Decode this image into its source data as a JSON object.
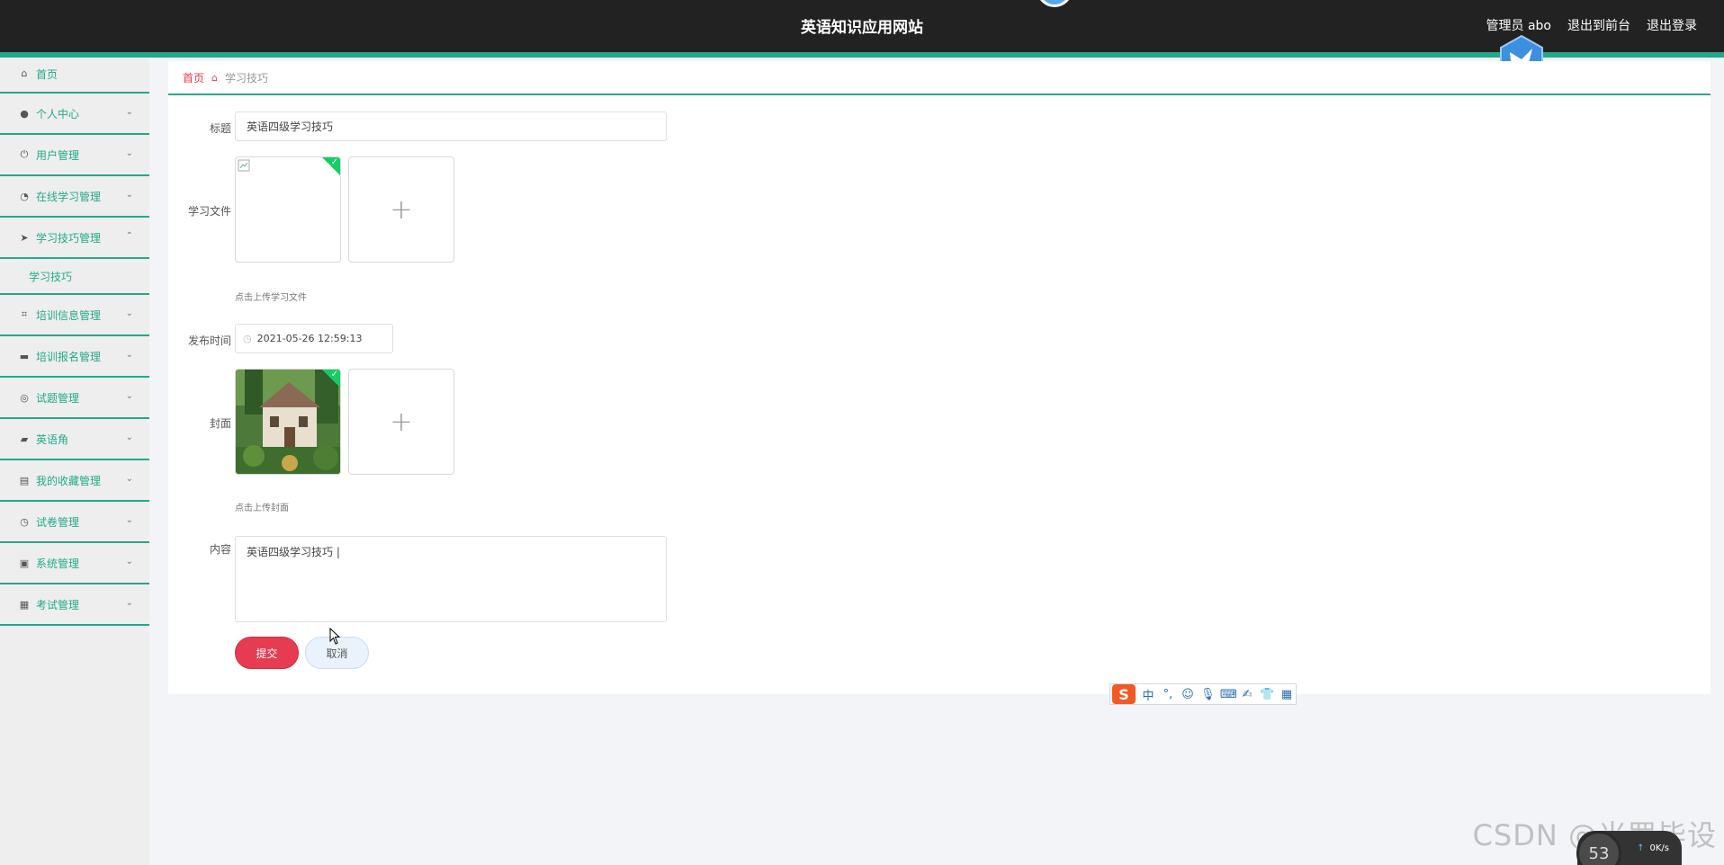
{
  "header": {
    "site_title": "英语知识应用网站",
    "user_label": "管理员 abo",
    "goto_front": "退出到前台",
    "logout": "退出登录"
  },
  "sidebar": {
    "items": [
      {
        "label": "首页",
        "icon": "home-icon",
        "expandable": false
      },
      {
        "label": "个人中心",
        "icon": "user-icon",
        "expandable": true
      },
      {
        "label": "用户管理",
        "icon": "power-icon",
        "expandable": true
      },
      {
        "label": "在线学习管理",
        "icon": "dashboard-icon",
        "expandable": true
      },
      {
        "label": "学习技巧管理",
        "icon": "send-icon",
        "expandable": true,
        "expanded": true
      },
      {
        "label": "培训信息管理",
        "icon": "crop-icon",
        "expandable": true
      },
      {
        "label": "培训报名管理",
        "icon": "comment-icon",
        "expandable": true
      },
      {
        "label": "试题管理",
        "icon": "globe-icon",
        "expandable": true
      },
      {
        "label": "英语角",
        "icon": "briefcase-icon",
        "expandable": true
      },
      {
        "label": "我的收藏管理",
        "icon": "printer-icon",
        "expandable": true
      },
      {
        "label": "试卷管理",
        "icon": "clock-icon",
        "expandable": true
      },
      {
        "label": "系统管理",
        "icon": "document-icon",
        "expandable": true
      },
      {
        "label": "考试管理",
        "icon": "clipboard-icon",
        "expandable": true
      }
    ],
    "subitem": "学习技巧"
  },
  "breadcrumb": {
    "home": "首页",
    "current": "学习技巧"
  },
  "form": {
    "title_label": "标题",
    "title_value": "英语四级学习技巧",
    "file_label": "学习文件",
    "file_hint": "点击上传学习文件",
    "time_label": "发布时间",
    "time_value": "2021-05-26 12:59:13",
    "cover_label": "封面",
    "cover_hint": "点击上传封面",
    "content_label": "内容",
    "content_value": "英语四级学习技巧 |",
    "submit": "提交",
    "cancel": "取消"
  },
  "ime": {
    "lang": "中"
  },
  "watermark": "CSDN @米罗毕设",
  "speed_widget": {
    "percent": "53",
    "rate": "0K/s"
  },
  "colors": {
    "accent": "#22a989",
    "header_bg": "#222222",
    "submit_bg": "#e63c52"
  }
}
